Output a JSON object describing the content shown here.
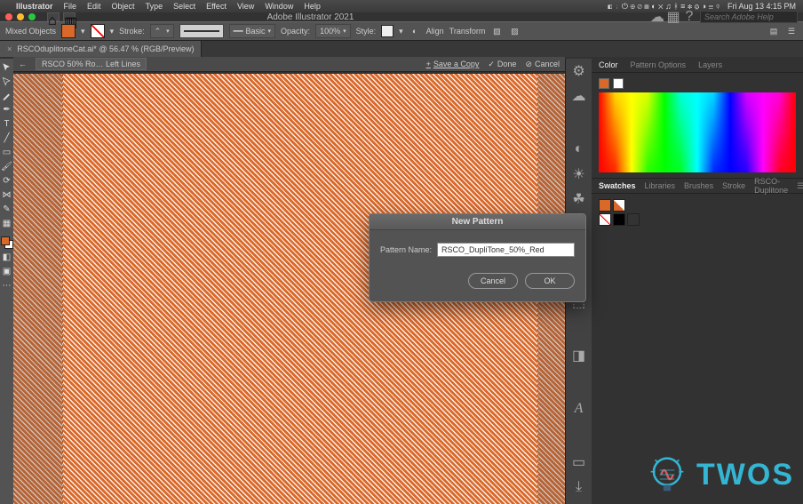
{
  "menubar": {
    "app_name": "Illustrator",
    "items": [
      "File",
      "Edit",
      "Object",
      "Type",
      "Select",
      "Effect",
      "View",
      "Window",
      "Help"
    ],
    "clock": "Fri Aug 13  4:15 PM"
  },
  "titlebar": {
    "title": "Adobe Illustrator 2021",
    "search_placeholder": "Search Adobe Help"
  },
  "options": {
    "selection_label": "Mixed Objects",
    "fill_color": "#d96829",
    "stroke_label": "Stroke:",
    "stroke_weight": "",
    "brush_def": "Basic",
    "opacity_label": "Opacity:",
    "opacity_value": "100%",
    "style_label": "Style:",
    "align_label": "Align",
    "transform_label": "Transform"
  },
  "tab": {
    "label": "RSCOduplitoneCat.ai* @ 56.47 % (RGB/Preview)"
  },
  "edit_bar": {
    "breadcrumb": "RSCO 50% Ro… Left Lines",
    "save_label": "Save a Copy",
    "done_label": "Done",
    "cancel_label": "Cancel"
  },
  "panels": {
    "color_tabs": [
      "Color",
      "Pattern Options",
      "Layers"
    ],
    "swatch_tabs": [
      "Swatches",
      "Libraries",
      "Brushes",
      "Stroke",
      "RSCO-Duplitone"
    ]
  },
  "dialog": {
    "title": "New Pattern",
    "field_label": "Pattern Name:",
    "field_value": "RSCO_DupliTone_50%_Red",
    "cancel": "Cancel",
    "ok": "OK"
  },
  "watermark": {
    "text": "TWOS"
  }
}
